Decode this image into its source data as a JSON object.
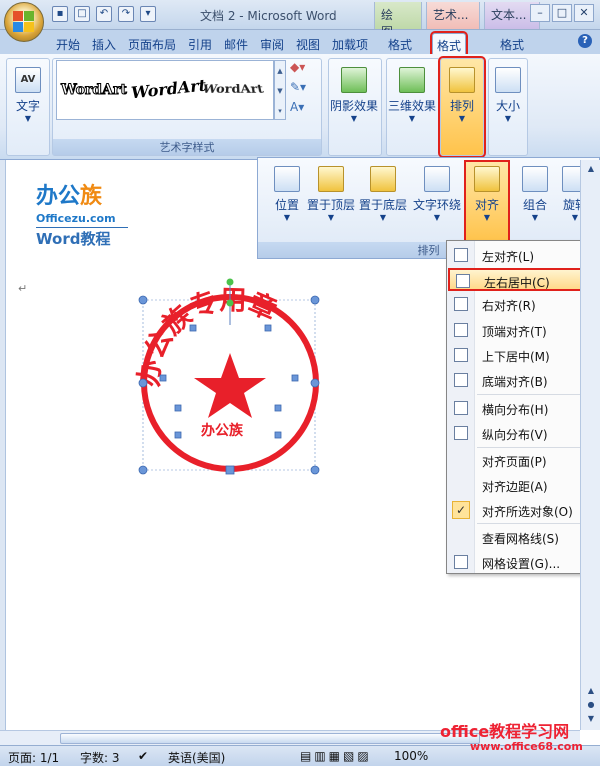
{
  "window": {
    "title": "文档 2 - Microsoft Word",
    "context_tabs": [
      "绘图...",
      "艺术...",
      "文本..."
    ]
  },
  "ribbon_tabs": [
    "开始",
    "插入",
    "页面布局",
    "引用",
    "邮件",
    "审阅",
    "视图",
    "加载项",
    "格式",
    "格式",
    "格式"
  ],
  "ribbon": {
    "text_btn": "文字",
    "wordart_samples": [
      "WordArt",
      "WordArt",
      "WordArt"
    ],
    "wordart_group": "艺术字样式",
    "shadow_btn": "阴影效果",
    "threed_btn": "三维效果",
    "arrange_btn": "排列",
    "size_btn": "大小"
  },
  "arrange_panel": {
    "buttons": [
      "位置",
      "置于顶层",
      "置于底层",
      "文字环绕",
      "对齐",
      "组合",
      "旋转"
    ],
    "group_label": "排列"
  },
  "brand": {
    "cn_part1": "办公",
    "cn_part2": "族",
    "en": "Officezu.com",
    "sub": "Word教程"
  },
  "stamp": {
    "arc_text": "办公族专用章",
    "center_text": "办公族"
  },
  "align_menu": {
    "items": [
      {
        "label": "左对齐(L)"
      },
      {
        "label": "左右居中(C)"
      },
      {
        "label": "右对齐(R)"
      },
      {
        "label": "顶端对齐(T)"
      },
      {
        "label": "上下居中(M)"
      },
      {
        "label": "底端对齐(B)"
      },
      {
        "label": "横向分布(H)"
      },
      {
        "label": "纵向分布(V)"
      },
      {
        "label": "对齐页面(P)"
      },
      {
        "label": "对齐边距(A)"
      },
      {
        "label": "对齐所选对象(O)"
      },
      {
        "label": "查看网格线(S)"
      },
      {
        "label": "网格设置(G)..."
      }
    ]
  },
  "statusbar": {
    "page": "页面: 1/1",
    "words": "字数: 3",
    "lang": "英语(美国)",
    "zoom": "100%"
  },
  "watermark": {
    "line1": "office教程学习网",
    "line2": "www.office68.com"
  },
  "colors": {
    "stamp_red": "#e8202a",
    "highlight_red": "#e0211b"
  }
}
